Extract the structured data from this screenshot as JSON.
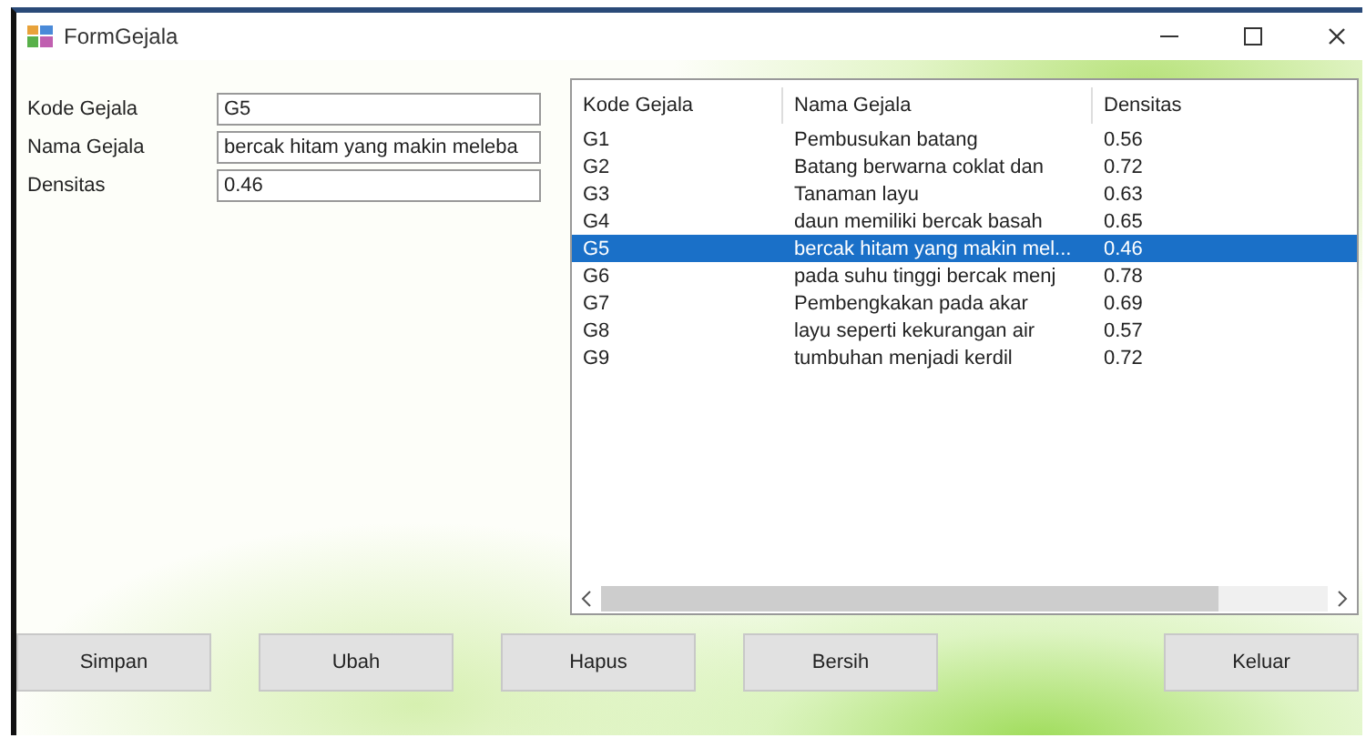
{
  "window": {
    "title": "FormGejala"
  },
  "form": {
    "fields": [
      {
        "label": "Kode Gejala",
        "value": "G5"
      },
      {
        "label": "Nama Gejala",
        "value": "bercak hitam yang makin meleba"
      },
      {
        "label": "Densitas",
        "value": "0.46"
      }
    ]
  },
  "table": {
    "columns": [
      "Kode Gejala",
      "Nama Gejala",
      "Densitas"
    ],
    "rows": [
      {
        "cells": [
          "G1",
          "Pembusukan batang",
          "0.56"
        ],
        "selected": false
      },
      {
        "cells": [
          "G2",
          "Batang berwarna coklat dan",
          "0.72"
        ],
        "selected": false
      },
      {
        "cells": [
          "G3",
          "Tanaman layu",
          "0.63"
        ],
        "selected": false
      },
      {
        "cells": [
          "G4",
          "daun memiliki bercak basah",
          "0.65"
        ],
        "selected": false
      },
      {
        "cells": [
          "G5",
          "bercak hitam yang makin mel...",
          "0.46"
        ],
        "selected": true
      },
      {
        "cells": [
          "G6",
          "pada suhu tinggi bercak menj",
          "0.78"
        ],
        "selected": false
      },
      {
        "cells": [
          "G7",
          "Pembengkakan pada akar",
          "0.69"
        ],
        "selected": false
      },
      {
        "cells": [
          "G8",
          "layu seperti kekurangan air",
          "0.57"
        ],
        "selected": false
      },
      {
        "cells": [
          "G9",
          "tumbuhan menjadi kerdil",
          "0.72"
        ],
        "selected": false
      }
    ]
  },
  "buttons": [
    "Simpan",
    "Ubah",
    "Hapus",
    "Bersih",
    "Keluar"
  ]
}
